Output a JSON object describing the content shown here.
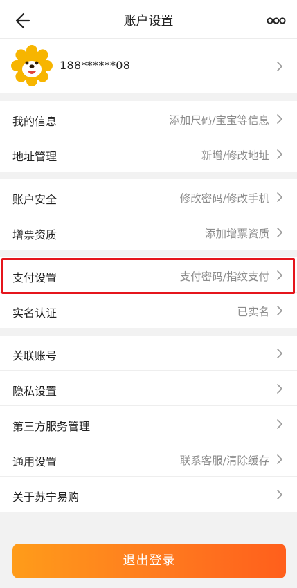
{
  "header": {
    "title": "账户设置",
    "back_icon": "back-arrow-icon",
    "more_icon": "more-options-icon"
  },
  "profile": {
    "phone": "188******08",
    "avatar_icon": "lion-mascot-avatar"
  },
  "groups": [
    {
      "rows": [
        {
          "label": "我的信息",
          "value": "添加尺码/宝宝等信息"
        },
        {
          "label": "地址管理",
          "value": "新增/修改地址"
        }
      ]
    },
    {
      "rows": [
        {
          "label": "账户安全",
          "value": "修改密码/修改手机"
        },
        {
          "label": "增票资质",
          "value": "添加增票资质"
        }
      ]
    },
    {
      "rows": [
        {
          "label": "支付设置",
          "value": "支付密码/指纹支付"
        },
        {
          "label": "实名认证",
          "value": "已实名"
        }
      ]
    },
    {
      "rows": [
        {
          "label": "关联账号",
          "value": ""
        },
        {
          "label": "隐私设置",
          "value": ""
        },
        {
          "label": "第三方服务管理",
          "value": ""
        },
        {
          "label": "通用设置",
          "value": "联系客服/清除缓存"
        },
        {
          "label": "关于苏宁易购",
          "value": ""
        }
      ]
    }
  ],
  "logout": {
    "label": "退出登录"
  },
  "colors": {
    "highlight_border": "#e5151c",
    "logout_gradient_start": "#ff9c1a",
    "logout_gradient_end": "#ff5f1c",
    "avatar_yellow": "#f7b500"
  }
}
